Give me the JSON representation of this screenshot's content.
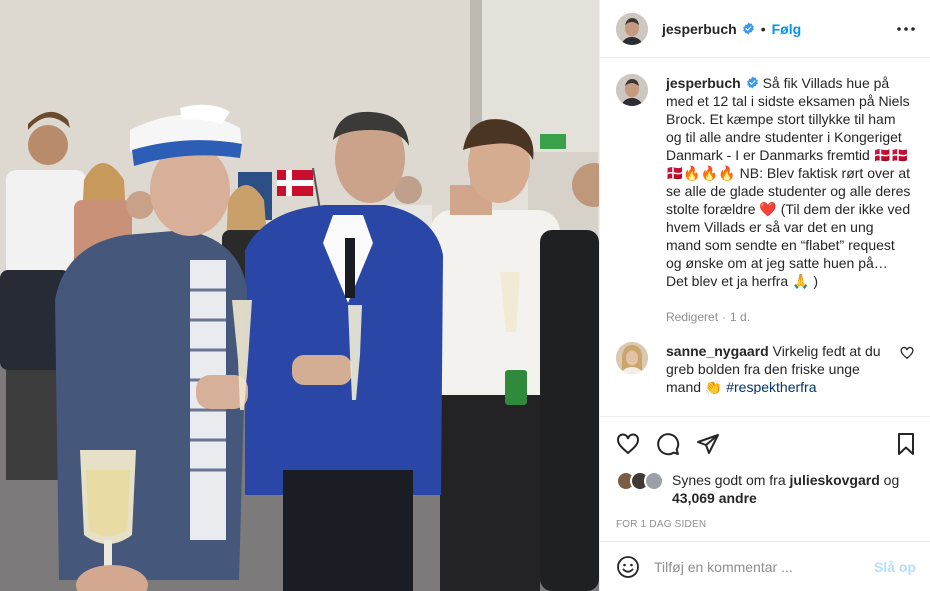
{
  "post": {
    "username": "jesperbuch",
    "separator": "•",
    "follow_label": "Følg",
    "more_icon": "more-horizontal-icon",
    "caption": {
      "username": "jesperbuch",
      "text": "Så fik Villads hue på med et 12 tal i sidste eksamen på Niels Brock. Et kæmpe stort tillykke til ham og til alle andre studenter i Kongeriget Danmark - I er Danmarks fremtid 🇩🇰🇩🇰🇩🇰🔥🔥🔥 NB: Blev faktisk rørt over at se alle de glade studenter og alle deres stolte forældre ❤️ (Til dem der ikke ved hvem Villads er så var det en ung mand som sendte en “flabet” request og ønske om at jeg satte huen på… Det blev et ja herfra 🙏 )",
      "edited_label": "Redigeret",
      "edited_sep": "·",
      "edited_age": "1 d."
    },
    "comment": {
      "username": "sanne_nygaard",
      "text": "Virkelig fedt at du greb bolden fra den friske unge mand 👏",
      "hashtag": "#respektherfra"
    },
    "likes": {
      "prefix": "Synes godt om fra",
      "user": "julieskovgard",
      "mid": "og",
      "count": "43,069 andre"
    },
    "timestamp": "FOR 1 DAG SIDEN",
    "add_comment": {
      "placeholder": "Tilføj en kommentar ...",
      "post_label": "Slå op"
    },
    "colors": {
      "accent": "#0095f6",
      "verified": "#3897f0",
      "post_disabled": "#b2dffc"
    }
  }
}
